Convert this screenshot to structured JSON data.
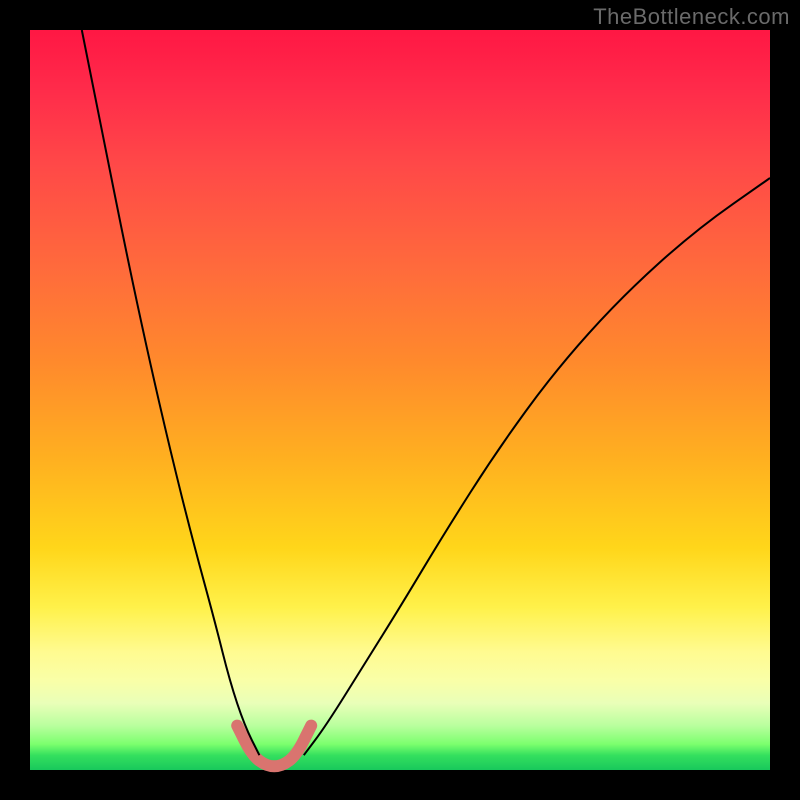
{
  "watermark": "TheBottleneck.com",
  "chart_data": {
    "type": "line",
    "title": "",
    "xlabel": "",
    "ylabel": "",
    "xlim": [
      0,
      100
    ],
    "ylim": [
      0,
      100
    ],
    "grid": false,
    "legend": false,
    "background_gradient": {
      "direction": "vertical",
      "stops": [
        {
          "pos": 0.0,
          "color": "#ff1744"
        },
        {
          "pos": 0.45,
          "color": "#ff8a2c"
        },
        {
          "pos": 0.78,
          "color": "#fff14a"
        },
        {
          "pos": 0.96,
          "color": "#7cff6e"
        },
        {
          "pos": 1.0,
          "color": "#18c85c"
        }
      ]
    },
    "series": [
      {
        "name": "bottleneck-curve-left",
        "stroke": "#000000",
        "stroke_width": 2,
        "x": [
          7,
          10,
          13,
          16,
          19,
          22,
          25,
          27,
          29,
          31
        ],
        "y": [
          100,
          85,
          70,
          56,
          43,
          31,
          20,
          12,
          6,
          2
        ]
      },
      {
        "name": "bottleneck-curve-right",
        "stroke": "#000000",
        "stroke_width": 2,
        "x": [
          37,
          40,
          45,
          50,
          56,
          63,
          71,
          80,
          90,
          100
        ],
        "y": [
          2,
          6,
          14,
          22,
          32,
          43,
          54,
          64,
          73,
          80
        ]
      },
      {
        "name": "bottleneck-floor-highlight",
        "stroke": "#d9746f",
        "stroke_width": 12,
        "linecap": "round",
        "x": [
          28,
          30,
          32,
          34,
          36,
          38
        ],
        "y": [
          6,
          2,
          0.5,
          0.5,
          2,
          6
        ]
      }
    ],
    "annotations": []
  }
}
